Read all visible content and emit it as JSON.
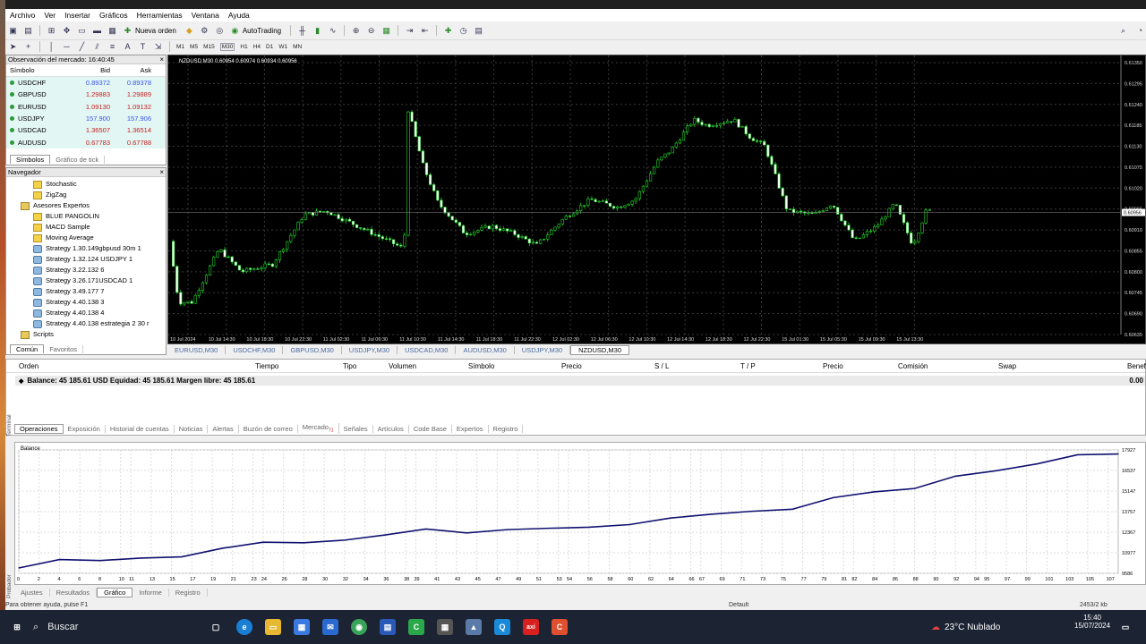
{
  "menu": [
    "Archivo",
    "Ver",
    "Insertar",
    "Gráficos",
    "Herramientas",
    "Ventana",
    "Ayuda"
  ],
  "toolbar": {
    "new_order": "Nueva orden",
    "autotrading": "AutoTrading",
    "timeframes": [
      "M1",
      "M5",
      "M15",
      "M30",
      "H1",
      "H4",
      "D1",
      "W1",
      "MN"
    ],
    "active_tf": "M30"
  },
  "market_watch": {
    "title": "Observación del mercado: 16:40:45",
    "headers": {
      "symbol": "Símbolo",
      "bid": "Bid",
      "ask": "Ask"
    },
    "rows": [
      {
        "symbol": "USDCHF",
        "bid": "0.89372",
        "ask": "0.89378",
        "down": false
      },
      {
        "symbol": "GBPUSD",
        "bid": "1.29883",
        "ask": "1.29889",
        "down": true
      },
      {
        "symbol": "EURUSD",
        "bid": "1.09130",
        "ask": "1.09132",
        "down": true
      },
      {
        "symbol": "USDJPY",
        "bid": "157.900",
        "ask": "157.906",
        "down": false
      },
      {
        "symbol": "USDCAD",
        "bid": "1.36507",
        "ask": "1.36514",
        "down": true
      },
      {
        "symbol": "AUDUSD",
        "bid": "0.67783",
        "ask": "0.67788",
        "down": true
      }
    ],
    "tabs": [
      "Símbolos",
      "Gráfico de tick"
    ]
  },
  "navigator": {
    "title": "Navegador",
    "items": [
      {
        "label": "Stochastic",
        "kind": "ind",
        "indent": 30
      },
      {
        "label": "ZigZag",
        "kind": "ind",
        "indent": 30
      },
      {
        "label": "Asesores Expertos",
        "kind": "fld",
        "indent": 16
      },
      {
        "label": "BLUE PANGOLIN",
        "kind": "ind",
        "indent": 30
      },
      {
        "label": "MACD Sample",
        "kind": "ind",
        "indent": 30
      },
      {
        "label": "Moving Average",
        "kind": "ind",
        "indent": 30
      },
      {
        "label": "Strategy 1.30.149gbpusd  30m   1",
        "kind": "ea",
        "indent": 30
      },
      {
        "label": "Strategy 1.32.124 USDJPY  1",
        "kind": "ea",
        "indent": 30
      },
      {
        "label": "Strategy 3.22.132  6",
        "kind": "ea",
        "indent": 30
      },
      {
        "label": "Strategy 3.26.171USDCAD 1",
        "kind": "ea",
        "indent": 30
      },
      {
        "label": "Strategy 3.49.177      7",
        "kind": "ea",
        "indent": 30
      },
      {
        "label": "Strategy 4.40.138  3",
        "kind": "ea",
        "indent": 30
      },
      {
        "label": "Strategy 4.40.138  4",
        "kind": "ea",
        "indent": 30
      },
      {
        "label": "Strategy 4.40.138 estrategia 2  30 r",
        "kind": "ea",
        "indent": 30
      },
      {
        "label": "Scripts",
        "kind": "fld",
        "indent": 16
      }
    ],
    "tabs": [
      "Común",
      "Favoritos"
    ]
  },
  "chart": {
    "header": "NZDUSD,M30  0.60954 0.60974 0.60934 0.60956",
    "price_labels": [
      "0.61350",
      "0.61295",
      "0.61240",
      "0.61185",
      "0.61130",
      "0.61075",
      "0.61020",
      "0.60965",
      "0.60910",
      "0.60855",
      "0.60800",
      "0.60745",
      "0.60690",
      "0.60635"
    ],
    "current_price": "0.60956",
    "time_labels": [
      "10 Jul 2024",
      "10 Jul 14:30",
      "10 Jul 18:30",
      "10 Jul 22:30",
      "11 Jul 02:30",
      "11 Jul 06:30",
      "11 Jul 10:30",
      "11 Jul 14:30",
      "11 Jul 18:30",
      "11 Jul 22:30",
      "12 Jul 02:30",
      "12 Jul 06:30",
      "12 Jul 10:30",
      "12 Jul 14:30",
      "12 Jul 18:30",
      "12 Jul 22:30",
      "15 Jul 01:30",
      "15 Jul 05:30",
      "15 Jul 09:30",
      "15 Jul 13:30"
    ],
    "tabs": [
      "EURUSD,M30",
      "USDCHF,M30",
      "GBPUSD,M30",
      "USDJPY,M30",
      "USDCAD,M30",
      "AUDUSD,M30",
      "USDJPY,M30",
      "NZDUSD,M30"
    ],
    "active_tab": "NZDUSD,M30"
  },
  "terminal": {
    "side_label": "Terminal",
    "headers": [
      "Orden",
      "Tiempo",
      "Tipo",
      "Volumen",
      "Símbolo",
      "Precio",
      "S / L",
      "T / P",
      "Precio",
      "Comisión",
      "Swap",
      "Beneficios"
    ],
    "balance_line": "Balance: 45 185.61 USD  Equidad: 45 185.61  Margen libre: 45 185.61",
    "balance_value": "0.00",
    "tabs": [
      "Operaciones",
      "Exposición",
      "Historial de cuentas",
      "Noticias",
      "Alertas",
      "Buzón de correo",
      "Mercado",
      "Señales",
      "Artículos",
      "Code Base",
      "Expertos",
      "Registro"
    ],
    "mercado_badge": "71",
    "active_tab": "Operaciones"
  },
  "tester": {
    "side_label": "Probador",
    "graph_label": "Balance",
    "y_labels": [
      "17927",
      "16537",
      "15147",
      "13757",
      "12367",
      "10977",
      "9586"
    ],
    "x_labels": [
      "0",
      "2",
      "4",
      "6",
      "8",
      "10",
      "11",
      "13",
      "15",
      "17",
      "19",
      "21",
      "23",
      "24",
      "26",
      "28",
      "30",
      "32",
      "34",
      "36",
      "38",
      "39",
      "41",
      "43",
      "45",
      "47",
      "49",
      "51",
      "53",
      "54",
      "56",
      "58",
      "60",
      "62",
      "64",
      "66",
      "67",
      "69",
      "71",
      "73",
      "75",
      "77",
      "79",
      "81",
      "82",
      "84",
      "86",
      "88",
      "90",
      "92",
      "94",
      "95",
      "97",
      "99",
      "101",
      "103",
      "105",
      "107"
    ],
    "tabs": [
      "Ajustes",
      "Resultados",
      "Gráfico",
      "Informe",
      "Registro"
    ],
    "active_tab": "Gráfico"
  },
  "chart_data": {
    "type": "line",
    "title": "",
    "legend_label": "Balance",
    "xlabel": "",
    "ylabel": "",
    "ylim": [
      9586,
      17927
    ],
    "x": [
      0,
      4,
      8,
      12,
      16,
      20,
      24,
      28,
      32,
      36,
      40,
      44,
      48,
      52,
      56,
      60,
      64,
      68,
      72,
      76,
      80,
      84,
      88,
      92,
      96,
      100,
      104,
      108
    ],
    "series": [
      {
        "name": "Balance",
        "values": [
          9950,
          10520,
          10450,
          10620,
          10700,
          11280,
          11690,
          11650,
          11830,
          12180,
          12580,
          12320,
          12540,
          12630,
          12700,
          12880,
          13320,
          13580,
          13780,
          13920,
          14700,
          15090,
          15320,
          16150,
          16520,
          16980,
          17600,
          17650
        ]
      }
    ]
  },
  "status": {
    "help": "Para obtener ayuda, pulse F1",
    "profile": "Default",
    "traffic": "2453/2 kb"
  },
  "taskbar": {
    "search": "Buscar",
    "weather": "23°C  Nublado",
    "time": "15:40",
    "date": "15/07/2024"
  }
}
